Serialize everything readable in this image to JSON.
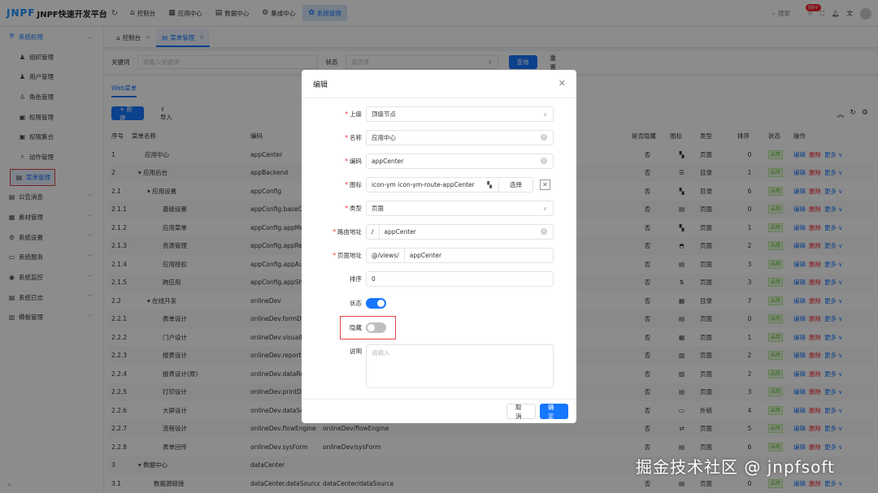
{
  "app": {
    "logo": "JNPF",
    "title": "JNPF快速开发平台"
  },
  "topnav": [
    {
      "icon": "home-icon",
      "glyph": "⌂",
      "label": "控制台"
    },
    {
      "icon": "grid-icon",
      "glyph": "▦",
      "label": "应用中心"
    },
    {
      "icon": "data-icon",
      "glyph": "▤",
      "label": "数据中心"
    },
    {
      "icon": "integrate-icon",
      "glyph": "⚙",
      "label": "集成中心"
    },
    {
      "icon": "settings-icon",
      "glyph": "✿",
      "label": "系统管理"
    }
  ],
  "topright": {
    "search_label": "搜索",
    "badge": "99+"
  },
  "sidebar": {
    "items": [
      {
        "label": "系统权限",
        "icon": "shield-icon",
        "glyph": "⛨",
        "kind": "parent-open",
        "chev": "︿"
      },
      {
        "label": "组织管理",
        "icon": "org-icon",
        "glyph": "♟",
        "kind": "sub"
      },
      {
        "label": "用户管理",
        "icon": "user-icon",
        "glyph": "♟",
        "kind": "sub"
      },
      {
        "label": "角色管理",
        "icon": "role-icon",
        "glyph": "♙",
        "kind": "sub"
      },
      {
        "label": "权限管理",
        "icon": "permission-icon",
        "glyph": "▣",
        "kind": "sub"
      },
      {
        "label": "权限集合",
        "icon": "collection-icon",
        "glyph": "▣",
        "kind": "sub"
      },
      {
        "label": "动作管理",
        "icon": "action-icon",
        "glyph": "⚡",
        "kind": "sub"
      },
      {
        "label": "菜单管理",
        "icon": "menu-icon",
        "glyph": "▤",
        "kind": "sub active"
      },
      {
        "label": "公告消息",
        "icon": "notice-icon",
        "glyph": "▤",
        "kind": "parent",
        "chev": "﹀"
      },
      {
        "label": "素材管理",
        "icon": "material-icon",
        "glyph": "▦",
        "kind": "parent",
        "chev": "﹀"
      },
      {
        "label": "系统设置",
        "icon": "gear-icon",
        "glyph": "⚙",
        "kind": "parent",
        "chev": "﹀"
      },
      {
        "label": "系统服务",
        "icon": "service-icon",
        "glyph": "▭",
        "kind": "parent",
        "chev": "﹀"
      },
      {
        "label": "系统监控",
        "icon": "monitor-icon",
        "glyph": "◉",
        "kind": "parent",
        "chev": "﹀"
      },
      {
        "label": "系统日志",
        "icon": "log-icon",
        "glyph": "▤",
        "kind": "parent",
        "chev": "﹀"
      },
      {
        "label": "模板管理",
        "icon": "template-icon",
        "glyph": "▥",
        "kind": "parent",
        "chev": "﹀"
      }
    ]
  },
  "pagetabs": [
    {
      "label": "控制台",
      "glyph": "⌂",
      "active": false
    },
    {
      "label": "菜单管理",
      "glyph": "▤",
      "active": true
    }
  ],
  "filter": {
    "keyword_label": "关键词",
    "keyword_placeholder": "请输入关键词",
    "status_label": "状态",
    "status_placeholder": "请选择",
    "query_button": "查询",
    "reset_button": "重置"
  },
  "content": {
    "subtab": "Web菜单",
    "new_button": "+ 新建",
    "import_button": "⇪ 导入"
  },
  "table": {
    "headers": [
      "序号",
      "菜单名称",
      "编码",
      "",
      "是否隐藏",
      "图标",
      "类型",
      "排序",
      "状态",
      "操作"
    ],
    "rows": [
      [
        "1",
        "",
        "应用中心",
        "appCenter",
        "",
        "否",
        "▚",
        "页面",
        "0"
      ],
      [
        "2",
        "▾ ",
        "应用后台",
        "appBackend",
        "",
        "否",
        "☰",
        "目录",
        "1"
      ],
      [
        "2.1",
        "▾ ",
        "应用设置",
        "appConfig",
        "",
        "否",
        "▚",
        "目录",
        "6"
      ],
      [
        "2.1.1",
        "",
        "基础设置",
        "appConfig.baseCo",
        "",
        "否",
        "▤",
        "页面",
        "0"
      ],
      [
        "2.1.2",
        "",
        "应用菜单",
        "appConfig.appMe",
        "",
        "否",
        "▚",
        "页面",
        "1"
      ],
      [
        "2.1.3",
        "",
        "资源管理",
        "appConfig.appRe",
        "",
        "否",
        "◓",
        "页面",
        "2"
      ],
      [
        "2.1.4",
        "",
        "应用授权",
        "appConfig.appAu",
        "",
        "否",
        "▤",
        "页面",
        "3"
      ],
      [
        "2.1.5",
        "",
        "跨应用",
        "appConfig.appSh",
        "",
        "否",
        "⇅",
        "页面",
        "3"
      ],
      [
        "2.2",
        "▾ ",
        "在线开发",
        "onlineDev",
        "",
        "否",
        "▦",
        "目录",
        "7"
      ],
      [
        "2.2.1",
        "",
        "表单设计",
        "onlineDev.formDe",
        "",
        "否",
        "▤",
        "页面",
        "0"
      ],
      [
        "2.2.2",
        "",
        "门户设计",
        "onlineDev.visualP",
        "",
        "否",
        "▦",
        "页面",
        "1"
      ],
      [
        "2.2.3",
        "",
        "报表设计",
        "onlineDev.report",
        "",
        "否",
        "▨",
        "页面",
        "2"
      ],
      [
        "2.2.4",
        "",
        "报表设计(原)",
        "onlineDev.dataRe",
        "",
        "否",
        "▨",
        "页面",
        "2"
      ],
      [
        "2.2.5",
        "",
        "打印设计",
        "onlineDev.printDe",
        "",
        "否",
        "▤",
        "页面",
        "3"
      ],
      [
        "2.2.6",
        "",
        "大屏设计",
        "onlineDev.dataScr",
        "",
        "否",
        "▭",
        "外链",
        "4"
      ],
      [
        "2.2.7",
        "",
        "流程设计",
        "onlineDev.flowEngine",
        "onlineDev/flowEngine",
        "否",
        "⇄",
        "页面",
        "5"
      ],
      [
        "2.2.8",
        "",
        "表单回传",
        "onlineDev.sysForm",
        "onlineDev/sysForm",
        "否",
        "▤",
        "页面",
        "6"
      ],
      [
        "3",
        "▾ ",
        "数据中心",
        "dataCenter",
        "",
        "",
        "",
        "",
        ""
      ],
      [
        "3.1",
        "",
        "数据源链接",
        "dataCenter.dataSource",
        "dataCenter/dataSource",
        "否",
        "▤",
        "页面",
        "0"
      ]
    ],
    "status_tag": "启用",
    "op_edit": "编辑",
    "op_delete": "删除",
    "op_more": "更多"
  },
  "modal": {
    "title": "编辑",
    "parent": {
      "label": "上级",
      "value": "顶级节点"
    },
    "name": {
      "label": "名称",
      "value": "应用中心"
    },
    "code": {
      "label": "编码",
      "value": "appCenter"
    },
    "icon": {
      "label": "图标",
      "value": "icon-ym icon-ym-route-appCenter",
      "select_button": "选择"
    },
    "type": {
      "label": "类型",
      "value": "页面"
    },
    "route": {
      "label": "路由地址",
      "prefix": "/",
      "value": "appCenter"
    },
    "page": {
      "label": "页面地址",
      "prefix": "@/views/",
      "value": "appCenter"
    },
    "sort": {
      "label": "排序",
      "value": "0"
    },
    "status": {
      "label": "状态",
      "on": true
    },
    "hidden": {
      "label": "隐藏",
      "on": false
    },
    "desc": {
      "label": "说明",
      "placeholder": "请输入"
    },
    "cancel_button": "取 消",
    "ok_button": "确 定"
  },
  "watermark": "掘金技术社区 @ jnpfsoft",
  "colors": {
    "primary": "#1677ff",
    "danger": "#f5222d",
    "success": "#52c41a",
    "highlight": "#e04343"
  }
}
